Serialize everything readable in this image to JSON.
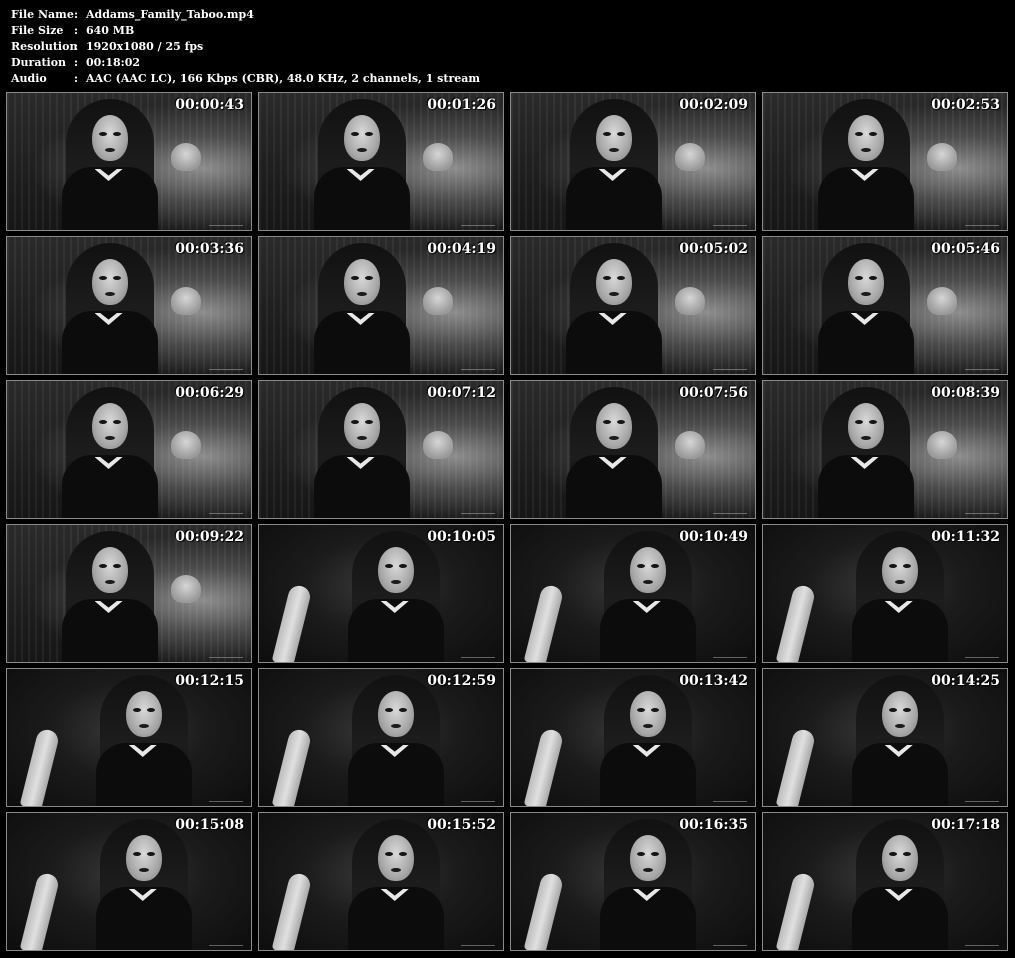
{
  "info": [
    {
      "key": "File Name",
      "sep": ":",
      "value": "Addams_Family_Taboo.mp4"
    },
    {
      "key": "File Size",
      "sep": ":",
      "value": "640 MB"
    },
    {
      "key": "Resolution",
      "sep": ":",
      "value": "1920x1080 / 25 fps"
    },
    {
      "key": "Duration",
      "sep": ":",
      "value": "00:18:02"
    },
    {
      "key": "Audio",
      "sep": ":",
      "value": "AAC (AAC LC), 166 Kbps (CBR), 48.0 KHz, 2 channels, 1 stream"
    }
  ],
  "thumbnails": [
    {
      "time": "00:00:43",
      "scene": "a"
    },
    {
      "time": "00:01:26",
      "scene": "a"
    },
    {
      "time": "00:02:09",
      "scene": "a"
    },
    {
      "time": "00:02:53",
      "scene": "a"
    },
    {
      "time": "00:03:36",
      "scene": "a"
    },
    {
      "time": "00:04:19",
      "scene": "a"
    },
    {
      "time": "00:05:02",
      "scene": "a"
    },
    {
      "time": "00:05:46",
      "scene": "a"
    },
    {
      "time": "00:06:29",
      "scene": "a"
    },
    {
      "time": "00:07:12",
      "scene": "a"
    },
    {
      "time": "00:07:56",
      "scene": "a"
    },
    {
      "time": "00:08:39",
      "scene": "a"
    },
    {
      "time": "00:09:22",
      "scene": "a"
    },
    {
      "time": "00:10:05",
      "scene": "b"
    },
    {
      "time": "00:10:49",
      "scene": "b"
    },
    {
      "time": "00:11:32",
      "scene": "b"
    },
    {
      "time": "00:12:15",
      "scene": "b"
    },
    {
      "time": "00:12:59",
      "scene": "b"
    },
    {
      "time": "00:13:42",
      "scene": "b"
    },
    {
      "time": "00:14:25",
      "scene": "b"
    },
    {
      "time": "00:15:08",
      "scene": "b"
    },
    {
      "time": "00:15:52",
      "scene": "b"
    },
    {
      "time": "00:16:35",
      "scene": "b"
    },
    {
      "time": "00:17:18",
      "scene": "b"
    }
  ],
  "colors": {
    "background": "#000000",
    "text": "#ffffff",
    "border": "#8a8a8a"
  }
}
